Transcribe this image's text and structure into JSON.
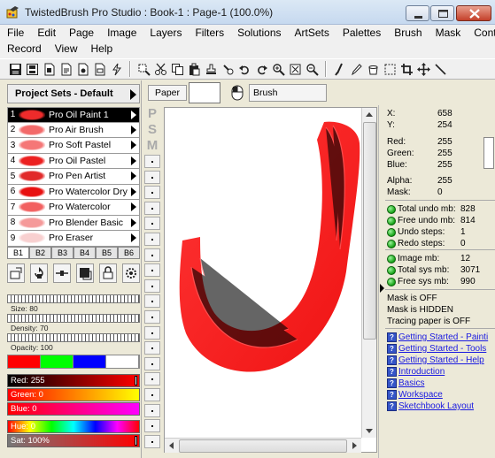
{
  "window": {
    "title": "TwistedBrush Pro Studio : Book-1 : Page-1 (100.0%)"
  },
  "menu": {
    "row1": [
      "File",
      "Edit",
      "Page",
      "Image",
      "Layers",
      "Filters",
      "Solutions",
      "ArtSets",
      "Palettes",
      "Brush",
      "Mask",
      "Control"
    ],
    "row2": [
      "Record",
      "View",
      "Help"
    ]
  },
  "toolbar": {
    "icons": [
      "save-icon",
      "floppy-icon",
      "page-icon",
      "page-icon",
      "page-icon",
      "page-icon",
      "lightning-icon",
      "cut-copy-icon",
      "scissors-icon",
      "copy-icon",
      "paste-icon",
      "stamp-icon",
      "stamp-icon",
      "undo-icon",
      "redo-icon",
      "zoom-in-icon",
      "fit-icon",
      "zoom-out-icon",
      "brush-tool-icon",
      "dropper-icon",
      "bucket-icon",
      "select-icon",
      "crop-icon",
      "move-icon",
      "line-icon"
    ]
  },
  "project_sets": {
    "title": "Project Sets - Default"
  },
  "brushes": [
    {
      "num": "1",
      "name": "Pro Oil Paint 1",
      "color": "#ee2b2b"
    },
    {
      "num": "2",
      "name": "Pro Air Brush",
      "color": "#f36a6a"
    },
    {
      "num": "3",
      "name": "Pro Soft Pastel",
      "color": "#f57777"
    },
    {
      "num": "4",
      "name": "Pro Oil Pastel",
      "color": "#ec2020"
    },
    {
      "num": "5",
      "name": "Pro Pen Artist",
      "color": "#e12a2a"
    },
    {
      "num": "6",
      "name": "Pro Watercolor Dry",
      "color": "#e81010"
    },
    {
      "num": "7",
      "name": "Pro Watercolor",
      "color": "#f26060"
    },
    {
      "num": "8",
      "name": "Pro Blender Basic",
      "color": "#f59a9a"
    },
    {
      "num": "9",
      "name": "Pro Eraser",
      "color": "#f8d0d0"
    }
  ],
  "brush_tabs": [
    "B1",
    "B2",
    "B3",
    "B4",
    "B5",
    "B6"
  ],
  "sliders": {
    "size_label": "Size: 80",
    "size_level": 0.8,
    "density_label": "Density: 70",
    "density_level": 0.7,
    "opacity_label": "Opacity: 100",
    "opacity_level": 1.0
  },
  "swatches": [
    "#ff0000",
    "#00ff00",
    "#0000ff",
    "#ffffff"
  ],
  "color_bars": {
    "red": "Red: 255",
    "green": "Green: 0",
    "blue": "Blue: 0",
    "hue": "Hue: 0",
    "sat": "Sat: 100%"
  },
  "paper": {
    "label": "Paper",
    "brush_label": "Brush"
  },
  "page_letters": [
    "P",
    "S",
    "M"
  ],
  "info": {
    "x_label": "X:",
    "x": "658",
    "y_label": "Y:",
    "y": "254",
    "red_label": "Red:",
    "red": "255",
    "green_label": "Green:",
    "green": "255",
    "blue_label": "Blue:",
    "blue": "255",
    "alpha_label": "Alpha:",
    "alpha": "255",
    "mask_label": "Mask:",
    "mask": "0"
  },
  "memory": [
    {
      "label": "Total undo mb:",
      "value": "828"
    },
    {
      "label": "Free undo mb:",
      "value": "814"
    },
    {
      "label": "Undo steps:",
      "value": "1"
    },
    {
      "label": "Redo steps:",
      "value": "0"
    }
  ],
  "memory2": [
    {
      "label": "Image mb:",
      "value": "12"
    },
    {
      "label": "Total sys mb:",
      "value": "3071"
    },
    {
      "label": "Free sys mb:",
      "value": "990"
    }
  ],
  "status": [
    "Mask is OFF",
    "Mask is HIDDEN",
    "Tracing paper is OFF"
  ],
  "help_links": [
    "Getting Started - Painti",
    "Getting Started - Tools",
    "Getting Started - Help",
    "Introduction",
    "Basics",
    "Workspace",
    "Sketchbook Layout"
  ]
}
